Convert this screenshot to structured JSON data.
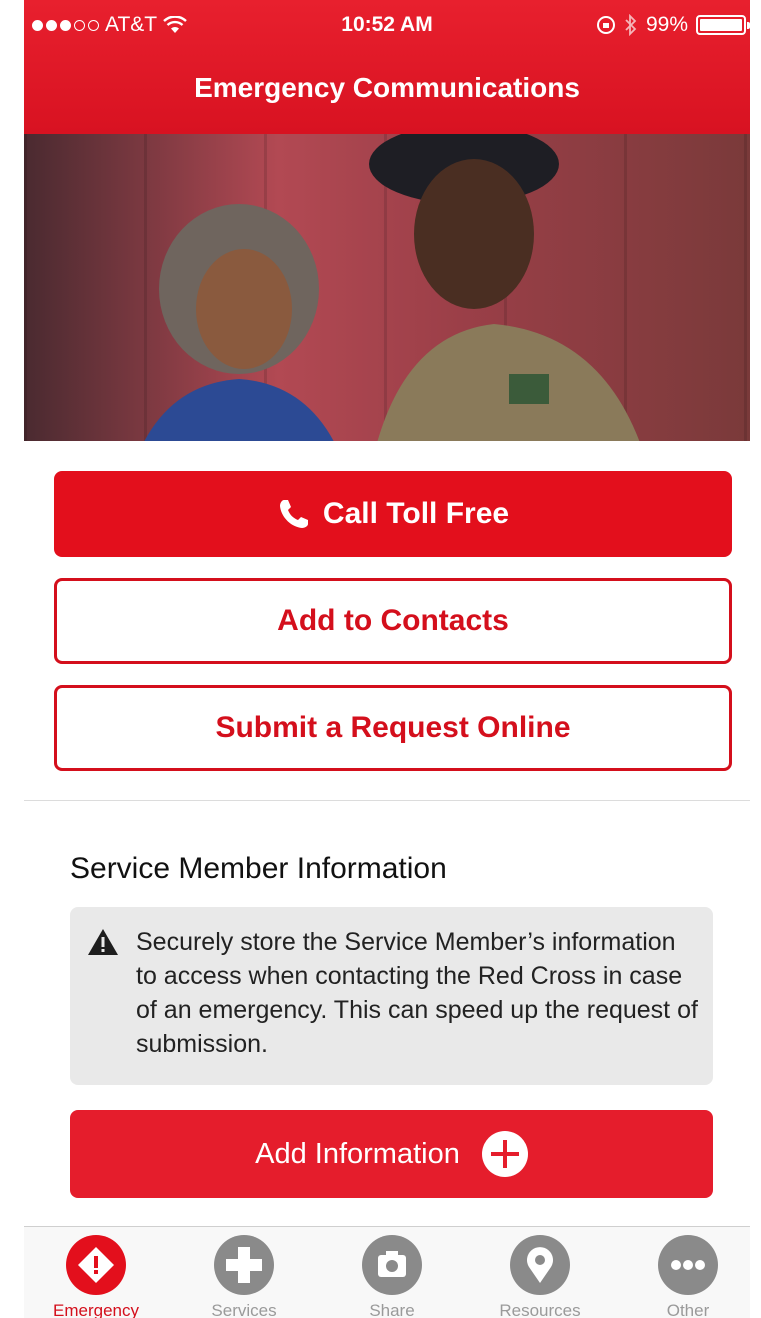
{
  "status_bar": {
    "carrier": "AT&T",
    "time": "10:52 AM",
    "battery": "99%",
    "battery_level": 0.99
  },
  "header": {
    "title": "Emergency Communications"
  },
  "actions": {
    "call_label": "Call Toll Free",
    "contacts_label": "Add to Contacts",
    "request_label": "Submit a Request Online"
  },
  "service_member": {
    "title": "Service Member Information",
    "notice": "Securely store the Service Member’s information to access when contacting the Red Cross in case of an emergency. This can speed up the request of submission.",
    "add_label": "Add Information"
  },
  "tabs": [
    {
      "label": "Emergency",
      "icon": "alert-diamond-icon",
      "active": true
    },
    {
      "label": "Services",
      "icon": "plus-icon",
      "active": false
    },
    {
      "label": "Share",
      "icon": "camera-icon",
      "active": false
    },
    {
      "label": "Resources",
      "icon": "location-pin-icon",
      "active": false
    },
    {
      "label": "Other",
      "icon": "more-dots-icon",
      "active": false
    }
  ],
  "colors": {
    "brand_red": "#e30f1c",
    "header_red": "#d81221",
    "tab_inactive": "#8a8a8a"
  }
}
